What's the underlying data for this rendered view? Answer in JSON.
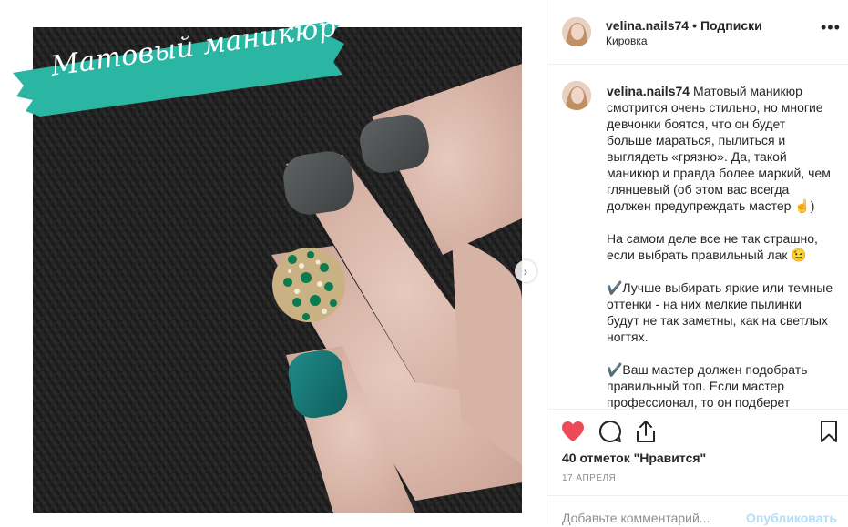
{
  "post": {
    "username": "velina.nails74",
    "follow_separator": "•",
    "follow_label": "Подписки",
    "location": "Кировка",
    "more_label": "•••",
    "banner_text": "Матовый маникюр",
    "caption_user": "velina.nails74",
    "caption_text": " Матовый маникюр смотрится очень стильно, но многие девчонки боятся, что он будет больше мараться, пылиться и выглядеть «грязно». Да, такой маникюр и правда более маркий, чем глянцевый (об этом вас всегда должен предупреждать мастер ☝️)\n\nНа самом деле все не так страшно, если выбрать правильный лак 😉\n\n✔️Лучше выбирать яркие или темные оттенки - на них мелкие пылинки будут не так заметны, как на светлых ногтях.\n\n✔️Ваш мастер должен подобрать правильный топ. Если мастер профессионал, то он подберет",
    "likes": "40 отметок \"Нравится\"",
    "date": "17 АПРЕЛЯ",
    "comment_placeholder": "Добавьте комментарий...",
    "publish_label": "Опубликовать"
  },
  "icons": [
    "heart-icon",
    "comment-icon",
    "share-icon",
    "bookmark-icon",
    "chevron-right-icon",
    "more-icon"
  ],
  "colors": {
    "like_red": "#ed4956",
    "banner_teal": "#2bb5a3",
    "publish_disabled": "#b2dffc"
  }
}
